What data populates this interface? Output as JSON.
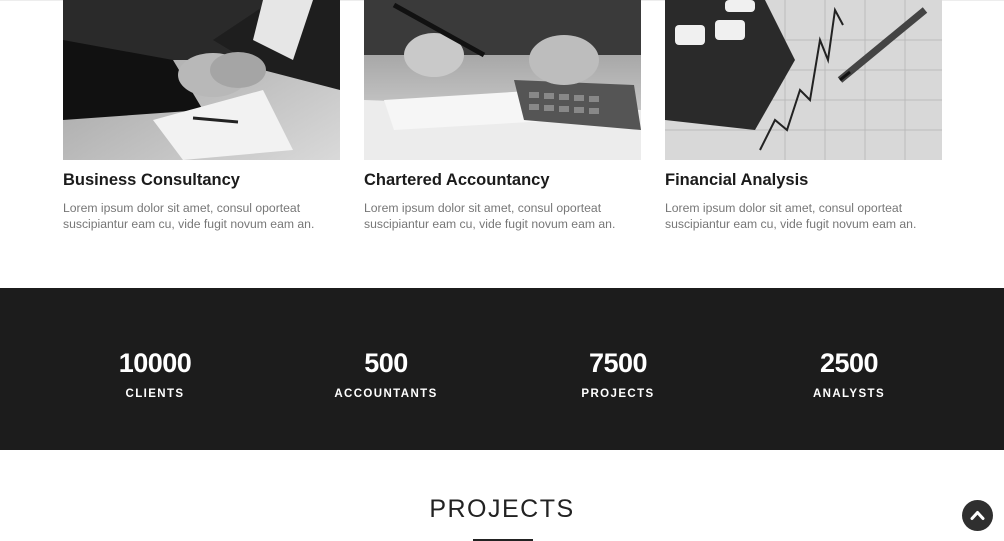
{
  "services": [
    {
      "title": "Business Consultancy",
      "description": "Lorem ipsum dolor sit amet, consul oporteat suscipiantur eam cu, vide fugit novum eam an.",
      "image": "handshake-photo"
    },
    {
      "title": "Chartered Accountancy",
      "description": "Lorem ipsum dolor sit amet, consul oporteat suscipiantur eam cu, vide fugit novum eam an.",
      "image": "accountant-calculator-photo"
    },
    {
      "title": "Financial Analysis",
      "description": "Lorem ipsum dolor sit amet, consul oporteat suscipiantur eam cu, vide fugit novum eam an.",
      "image": "financial-chart-photo"
    }
  ],
  "stats": [
    {
      "value": "10000",
      "label": "CLIENTS"
    },
    {
      "value": "500",
      "label": "ACCOUNTANTS"
    },
    {
      "value": "7500",
      "label": "PROJECTS"
    },
    {
      "value": "2500",
      "label": "ANALYSTS"
    }
  ],
  "projects": {
    "title": "PROJECTS"
  },
  "back_to_top": {
    "icon": "chevron-up-icon"
  },
  "colors": {
    "stats_background": "#1c1c1c",
    "text_dark": "#1b1b1b",
    "text_muted": "#777777",
    "button_bg": "#2f2f2f"
  }
}
